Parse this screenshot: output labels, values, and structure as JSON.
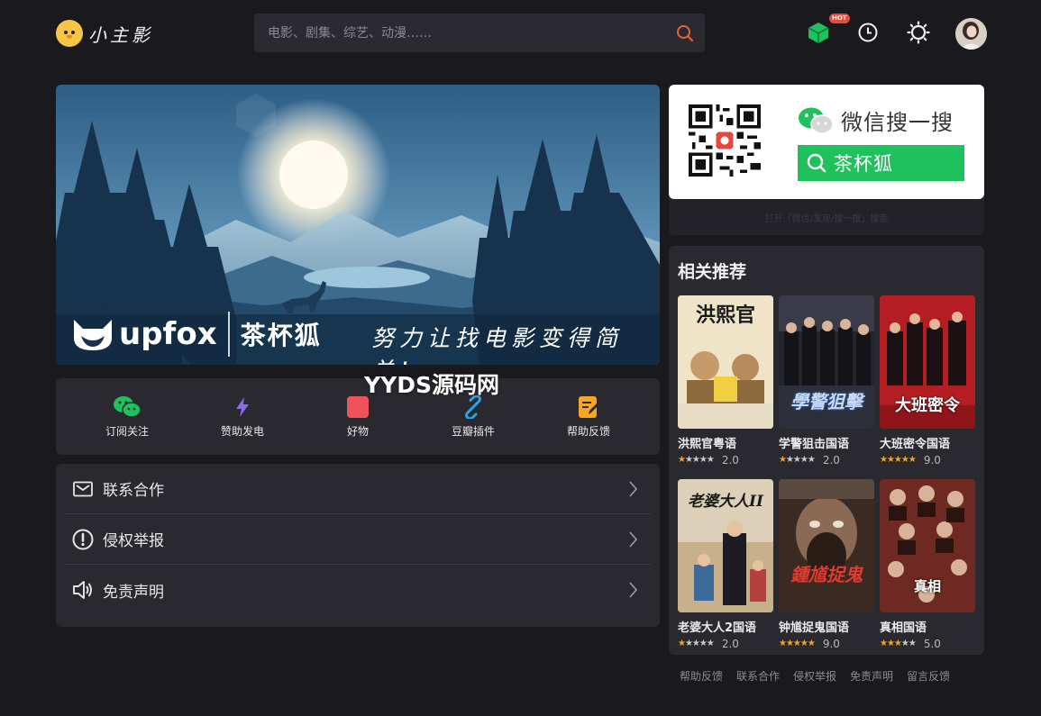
{
  "header": {
    "logo_text": "小主影",
    "search_placeholder": "电影、剧集、综艺、动漫……",
    "hot_badge": "HOT"
  },
  "banner": {
    "brand_en": "upfox",
    "brand_cn": "茶杯狐",
    "slogan": "努力让找电影变得简单!"
  },
  "watermark": "YYDS源码网",
  "quick_links": [
    {
      "label": "订阅关注",
      "icon": "wechat-icon",
      "color": "#1fc15c"
    },
    {
      "label": "赞助发电",
      "icon": "lightning-icon",
      "color": "#8b6cf0"
    },
    {
      "label": "好物",
      "icon": "bag-icon",
      "color": "#f0525c"
    },
    {
      "label": "豆瓣插件",
      "icon": "link-icon",
      "color": "#2aa3e8"
    },
    {
      "label": "帮助反馈",
      "icon": "edit-icon",
      "color": "#f5a623"
    }
  ],
  "menu": [
    {
      "label": "联系合作",
      "icon": "mail-icon"
    },
    {
      "label": "侵权举报",
      "icon": "warning-icon"
    },
    {
      "label": "免责声明",
      "icon": "speaker-icon"
    }
  ],
  "wechat": {
    "title": "微信搜一搜",
    "search_text": "茶杯狐",
    "hint": "打开「微信/发现/搜一搜」搜索"
  },
  "recommend": {
    "title": "相关推荐",
    "items": [
      {
        "title": "洪熙官粤语",
        "score": "2.0",
        "stars": 1,
        "poster_text": "洪熙官",
        "bg": "#e9dcc0"
      },
      {
        "title": "学警狙击国语",
        "score": "2.0",
        "stars": 1,
        "poster_text": "學警狙擊",
        "bg": "#2b2d38"
      },
      {
        "title": "大班密令国语",
        "score": "9.0",
        "stars": 5,
        "poster_text": "大班密令",
        "bg": "#b31e24"
      },
      {
        "title": "老婆大人2国语",
        "score": "2.0",
        "stars": 1,
        "poster_text": "老婆大人II",
        "bg": "#d9cdb8"
      },
      {
        "title": "钟馗捉鬼国语",
        "score": "9.0",
        "stars": 5,
        "poster_text": "鍾馗捉鬼",
        "bg": "#5a3b2c"
      },
      {
        "title": "真相国语",
        "score": "5.0",
        "stars": 3,
        "poster_text": "真相",
        "bg": "#7a2a22"
      }
    ]
  },
  "footer": [
    "帮助反馈",
    "联系合作",
    "侵权举报",
    "免责声明",
    "留言反馈"
  ],
  "colors": {
    "background": "#1a191e",
    "panel": "#2a292f",
    "accent_search": "#e8633a",
    "wechat_green": "#1fc15c",
    "star": "#f3a423"
  }
}
